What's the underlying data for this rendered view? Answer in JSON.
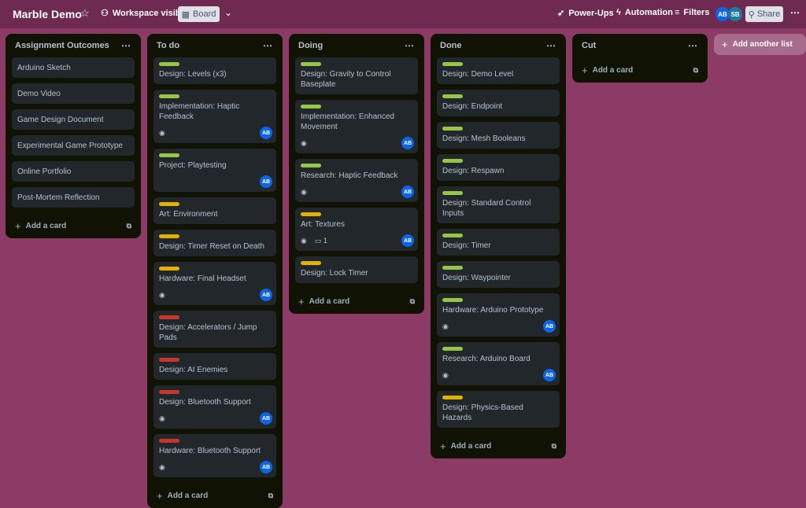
{
  "header": {
    "title": "Marble Demo",
    "visibility": "Workspace visible",
    "view": "Board",
    "power_ups": "Power-Ups",
    "automation": "Automation",
    "filters": "Filters",
    "share": "Share",
    "members": [
      {
        "initials": "AB",
        "color": "#0c66e4"
      },
      {
        "initials": "SB",
        "color": "#1d7a9e"
      }
    ]
  },
  "colors": {
    "green": "#94c748",
    "yellow": "#e2b203",
    "red": "#c9372c",
    "avatar": "#0c66e4"
  },
  "add_card_label": "Add a card",
  "add_list_label": "Add another list",
  "lists": [
    {
      "title": "Assignment Outcomes",
      "cards": [
        {
          "title": "Arduino Sketch"
        },
        {
          "title": "Demo Video"
        },
        {
          "title": "Game Design Document"
        },
        {
          "title": "Experimental Game Prototype"
        },
        {
          "title": "Online Portfolio"
        },
        {
          "title": "Post-Mortem Reflection"
        }
      ]
    },
    {
      "title": "To do",
      "cards": [
        {
          "title": "Design: Levels (x3)",
          "label": "green"
        },
        {
          "title": "Implementation: Haptic Feedback",
          "label": "green",
          "watch": true,
          "avatar": "AB"
        },
        {
          "title": "Project: Playtesting",
          "label": "green",
          "avatar": "AB"
        },
        {
          "title": "Art: Environment",
          "label": "yellow"
        },
        {
          "title": "Design: Timer Reset on Death",
          "label": "yellow"
        },
        {
          "title": "Hardware: Final Headset",
          "label": "yellow",
          "watch": true,
          "avatar": "AB"
        },
        {
          "title": "Design: Accelerators / Jump Pads",
          "label": "red"
        },
        {
          "title": "Design: AI Enemies",
          "label": "red"
        },
        {
          "title": "Design: Bluetooth Support",
          "label": "red",
          "watch": true,
          "avatar": "AB"
        },
        {
          "title": "Hardware: Bluetooth Support",
          "label": "red",
          "watch": true,
          "avatar": "AB"
        }
      ]
    },
    {
      "title": "Doing",
      "cards": [
        {
          "title": "Design: Gravity to Control Baseplate",
          "label": "green"
        },
        {
          "title": "Implementation: Enhanced Movement",
          "label": "green",
          "watch": true,
          "avatar": "AB"
        },
        {
          "title": "Research: Haptic Feedback",
          "label": "green",
          "watch": true,
          "avatar": "AB"
        },
        {
          "title": "Art: Textures",
          "label": "yellow",
          "watch": true,
          "comments": "1",
          "avatar": "AB"
        },
        {
          "title": "Design: Lock Timer",
          "label": "yellow"
        }
      ]
    },
    {
      "title": "Done",
      "cards": [
        {
          "title": "Design: Demo Level",
          "label": "green"
        },
        {
          "title": "Design: Endpoint",
          "label": "green"
        },
        {
          "title": "Design: Mesh Booleans",
          "label": "green"
        },
        {
          "title": "Design: Respawn",
          "label": "green"
        },
        {
          "title": "Design: Standard Control Inputs",
          "label": "green"
        },
        {
          "title": "Design: Timer",
          "label": "green"
        },
        {
          "title": "Design: Waypointer",
          "label": "green"
        },
        {
          "title": "Hardware: Arduino Prototype",
          "label": "green",
          "watch": true,
          "avatar": "AB"
        },
        {
          "title": "Research: Arduino Board",
          "label": "green",
          "watch": true,
          "avatar": "AB"
        },
        {
          "title": "Design: Physics-Based Hazards",
          "label": "yellow"
        }
      ]
    },
    {
      "title": "Cut",
      "cards": []
    }
  ]
}
